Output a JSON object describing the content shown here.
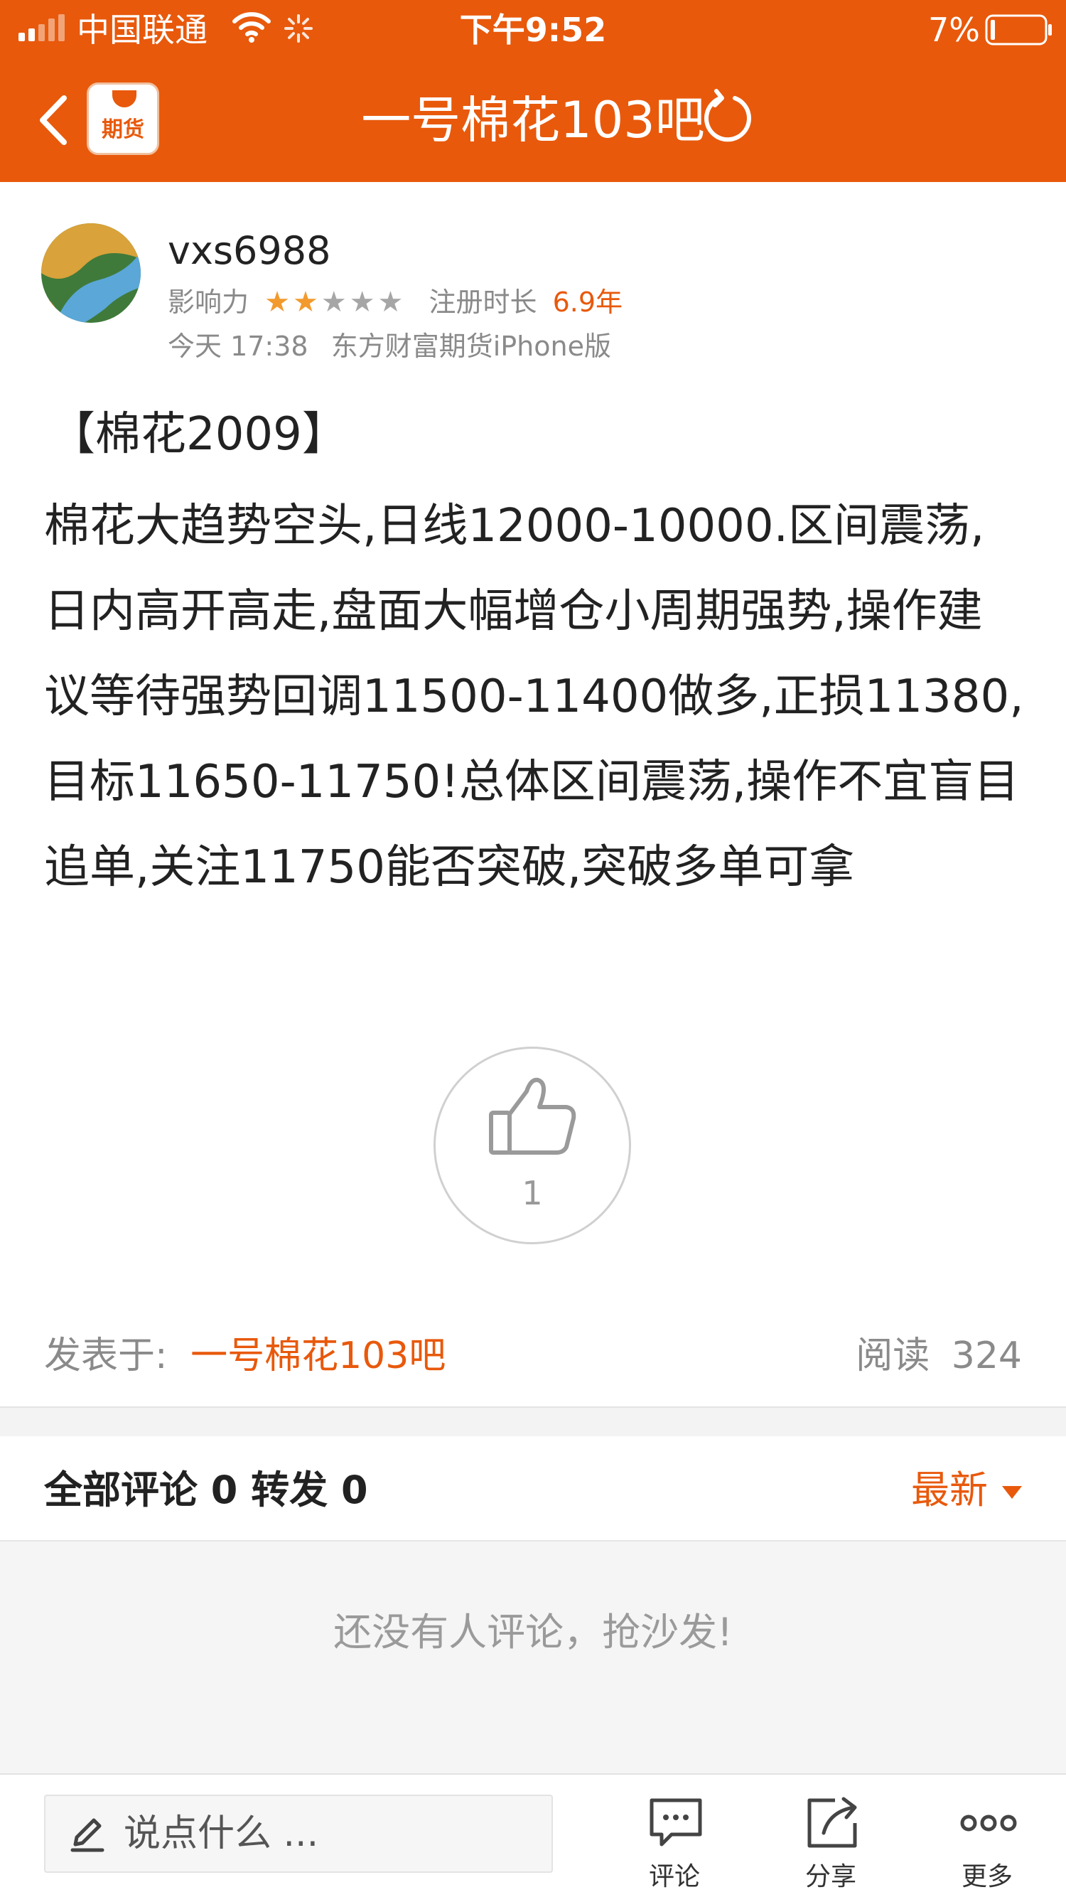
{
  "status_bar": {
    "carrier": "中国联通",
    "time": "下午9:52",
    "battery": "7%"
  },
  "nav": {
    "back_icon": "chevron-left-icon",
    "app_badge": "期货",
    "title": "一号棉花103吧",
    "refresh_icon": "refresh-icon"
  },
  "post": {
    "username": "vxs6988",
    "influence_label": "影响力",
    "influence_stars": 2,
    "influence_max": 5,
    "register_label": "注册时长",
    "register_value": "6.9年",
    "timestamp": "今天 17:38",
    "source": "东方财富期货iPhone版",
    "heading": "【棉花2009】",
    "body": "棉花大趋势空头,日线12000-10000.区间震荡,日内高开高走,盘面大幅增仓小周期强势,操作建议等待强势回调11500-11400做多,正损11380,目标11650-11750!总体区间震荡,操作不宜盲目追单,关注11750能否突破,突破多单可拿",
    "like_count": "1",
    "posted_in_label": "发表于:",
    "posted_in_value": "一号棉花103吧",
    "read_label": "阅读",
    "read_count": "324"
  },
  "comments": {
    "header": "全部评论 0 转发 0",
    "sort_label": "最新",
    "empty_text": "还没有人评论，抢沙发!"
  },
  "bottom_bar": {
    "input_placeholder": "说点什么 ...",
    "comment_label": "评论",
    "share_label": "分享",
    "more_label": "更多"
  },
  "colors": {
    "brand": "#e8590c",
    "star_on": "#f29a2e",
    "star_off": "#a6a6a6"
  }
}
